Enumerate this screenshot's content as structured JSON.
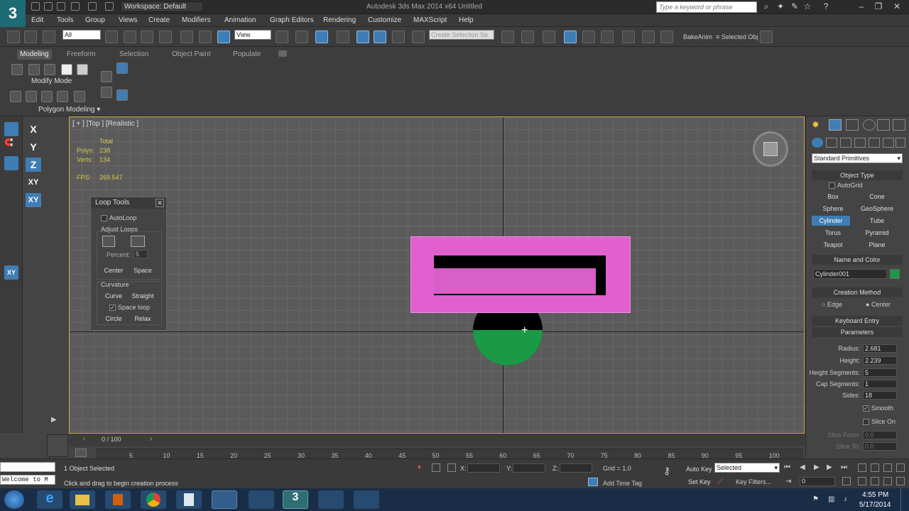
{
  "titlebar": {
    "workspace": "Workspace: Default",
    "app_title": "Autodesk 3ds Max 2014 x64    Untitled",
    "search_placeholder": "Type a keyword or phrase"
  },
  "menu": [
    "Edit",
    "Tools",
    "Group",
    "Views",
    "Create",
    "Modifiers",
    "Animation",
    "Graph Editors",
    "Rendering",
    "Customize",
    "MAXScript",
    "Help"
  ],
  "toolbar": {
    "selection_filter": "All",
    "ref_coord": "View",
    "named_selection_placeholder": "Create Selection Se",
    "bake_anim": "BakeAnim",
    "selected_obj": "≡ Selected Obj"
  },
  "ribbon": {
    "tabs": [
      "Modeling",
      "Freeform",
      "Selection",
      "Object Paint",
      "Populate"
    ],
    "modify_mode": "Modify Mode",
    "polygon_modeling": "Polygon Modeling"
  },
  "axis_buttons": [
    "X",
    "Y",
    "Z",
    "XY",
    "XY"
  ],
  "viewport": {
    "label": "[ + ] [Top ] [Realistic ]",
    "stats_total": "Total",
    "polys_label": "Polys:",
    "polys": "238",
    "verts_label": "Verts:",
    "verts": "134",
    "fps_label": "FPS:",
    "fps": "269.547"
  },
  "loop_tools": {
    "title": "Loop Tools",
    "autoloop": "AutoLoop",
    "adjust_loops": "Adjust Loops",
    "percent_label": "Percent:",
    "percent": "5",
    "center": "Center",
    "space": "Space",
    "curvature": "Curvature",
    "curve": "Curve",
    "straight": "Straight",
    "space_loop": "Space loop",
    "circle": "Circle",
    "relax": "Relax"
  },
  "command_panel": {
    "category": "Standard Primitives",
    "object_type": "Object Type",
    "autogrid": "AutoGrid",
    "buttons": [
      [
        "Box",
        "Cone"
      ],
      [
        "Sphere",
        "GeoSphere"
      ],
      [
        "Cylinder",
        "Tube"
      ],
      [
        "Torus",
        "Pyramid"
      ],
      [
        "Teapot",
        "Plane"
      ]
    ],
    "name_and_color": "Name and Color",
    "object_name": "Cylinder001",
    "object_color": "#1a9a46",
    "creation_method": "Creation Method",
    "edge": "Edge",
    "center": "Center",
    "keyboard_entry": "Keyboard Entry",
    "parameters": "Parameters",
    "params": [
      {
        "label": "Radius:",
        "value": "2.681"
      },
      {
        "label": "Height:",
        "value": "2.239"
      },
      {
        "label": "Height Segments:",
        "value": "5"
      },
      {
        "label": "Cap Segments:",
        "value": "1"
      },
      {
        "label": "Sides:",
        "value": "18"
      }
    ],
    "smooth": "Smooth",
    "slice_on": "Slice On",
    "slice_from_label": "Slice From:",
    "slice_from": "0.0",
    "slice_to_label": "Slice To:",
    "slice_to": "0.0"
  },
  "timeline": {
    "frame": "0 / 100",
    "ticks": [
      "5",
      "10",
      "15",
      "20",
      "25",
      "30",
      "35",
      "40",
      "45",
      "50",
      "55",
      "60",
      "65",
      "70",
      "75",
      "80",
      "85",
      "90",
      "95",
      "100"
    ]
  },
  "status": {
    "maxscript": "Welcome to M",
    "selected": "1 Object Selected",
    "prompt": "Click and drag to begin creation process",
    "x_label": "X:",
    "y_label": "Y:",
    "z_label": "Z:",
    "grid": "Grid = 1.0",
    "add_time_tag": "Add Time Tag",
    "auto_key": "Auto Key",
    "set_key": "Set Key",
    "key_mode": "Selected",
    "key_filters": "Key Filters...",
    "current_frame": "0"
  },
  "taskbar": {
    "time": "4:55 PM",
    "date": "5/17/2014"
  },
  "colors": {
    "accent": "#3f7db4",
    "box": "#e25fd0",
    "sphere_green": "#1a9a46"
  }
}
